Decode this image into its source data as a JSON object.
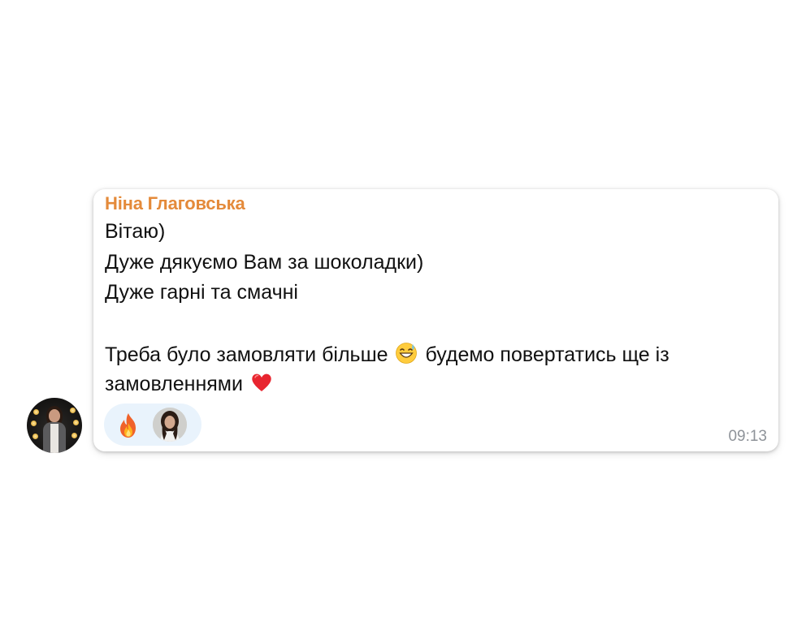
{
  "chat": {
    "message": {
      "sender_name": "Ніна Глаговська",
      "lines": [
        "Вітаю)",
        "Дуже дякуємо Вам за шоколадки)",
        "Дуже гарні та смачні",
        "",
        "Треба було замовляти більше",
        "будемо повертатись ще із",
        "замовленнями"
      ],
      "time": "09:13",
      "reactions": [
        {
          "emoji": "fire-icon",
          "reacted_by_avatar": "user-avatar"
        }
      ]
    }
  },
  "colors": {
    "sender_name": "#e48a3a",
    "reaction_pill": "#e9f3fc",
    "timestamp": "#8e9399",
    "text": "#111111"
  }
}
